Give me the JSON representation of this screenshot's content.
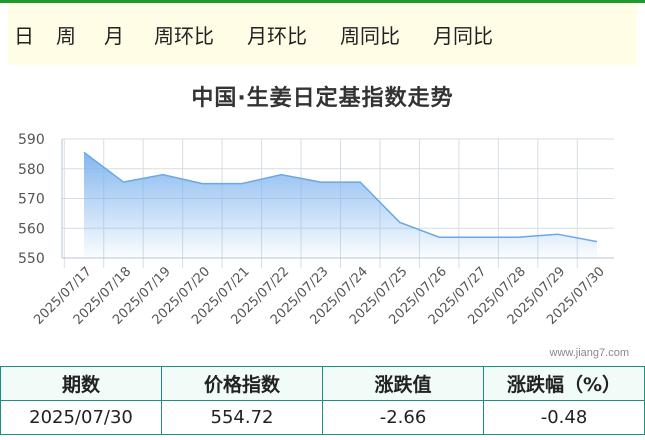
{
  "tabs": [
    {
      "label": "日",
      "active": true
    },
    {
      "label": "周",
      "active": false
    },
    {
      "label": "月",
      "active": false
    },
    {
      "label": "周环比",
      "active": false
    },
    {
      "label": "月环比",
      "active": false
    },
    {
      "label": "周同比",
      "active": false
    },
    {
      "label": "月同比",
      "active": false
    }
  ],
  "watermark": "www.jiang7.com",
  "summary": {
    "headers": [
      "期数",
      "价格指数",
      "涨跌值",
      "涨跌幅（%）"
    ],
    "row": [
      "2025/07/30",
      "554.72",
      "-2.66",
      "-0.48"
    ]
  },
  "colors": {
    "tab_active": "#129616",
    "tab_bar": "#fffde6",
    "line": "#6aa8e8",
    "area_top": "#7db3ee",
    "table_border": "#1d8f7e"
  },
  "chart_data": {
    "type": "area",
    "title": "中国·生姜日定基指数走势",
    "xlabel": "",
    "ylabel": "",
    "ylim": [
      550,
      590
    ],
    "yticks": [
      550,
      560,
      570,
      580,
      590
    ],
    "grid": true,
    "legend": "none",
    "categories": [
      "2025/07/17",
      "2025/07/18",
      "2025/07/19",
      "2025/07/20",
      "2025/07/21",
      "2025/07/22",
      "2025/07/23",
      "2025/07/24",
      "2025/07/25",
      "2025/07/26",
      "2025/07/27",
      "2025/07/28",
      "2025/07/29",
      "2025/07/30"
    ],
    "values": [
      585.5,
      575.5,
      578.0,
      575.0,
      575.0,
      578.0,
      575.5,
      575.5,
      562.0,
      557.0,
      557.0,
      557.0,
      558.0,
      555.5
    ]
  }
}
